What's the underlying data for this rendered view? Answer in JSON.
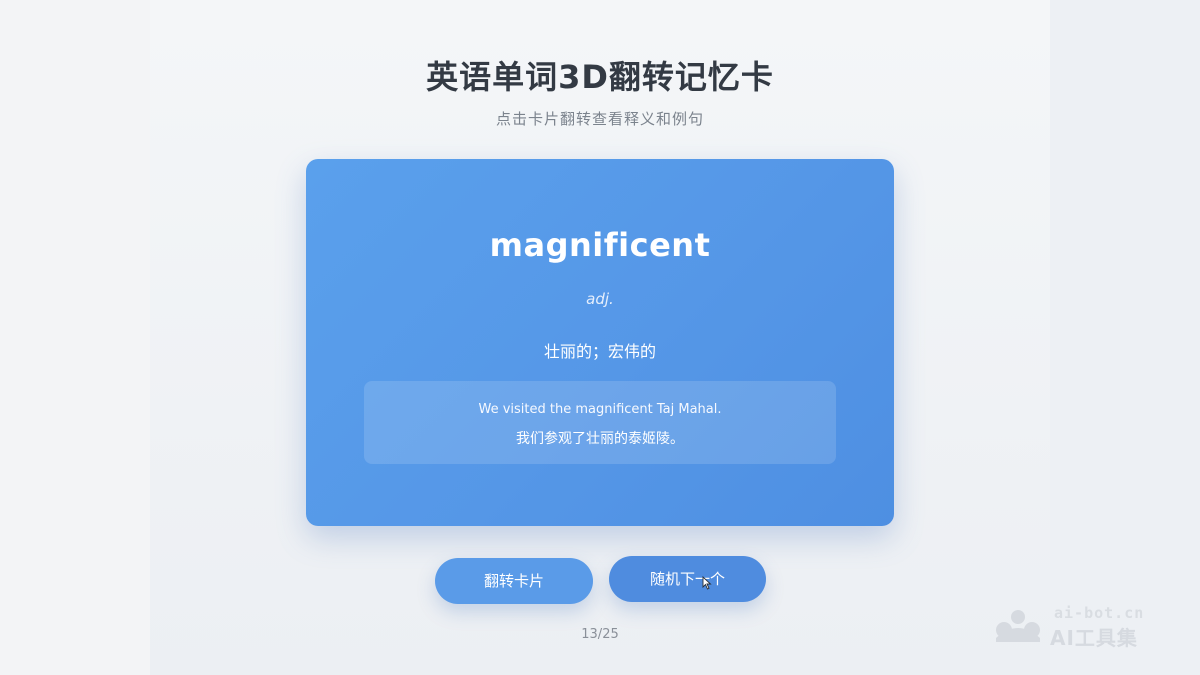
{
  "header": {
    "title": "英语单词3D翻转记忆卡",
    "subtitle": "点击卡片翻转查看释义和例句"
  },
  "card": {
    "word": "magnificent",
    "part_of_speech": "adj.",
    "meaning": "壮丽的；宏伟的",
    "example_en": "We visited the magnificent Taj Mahal.",
    "example_zh": "我们参观了壮丽的泰姬陵。"
  },
  "controls": {
    "flip_label": "翻转卡片",
    "next_label": "随机下一个"
  },
  "progress": {
    "counter": "13/25"
  },
  "watermark": {
    "domain": "ai-bot.cn",
    "name": "AI工具集",
    "icon": "cloud-logo-icon"
  },
  "colors": {
    "card_bg": "#5597e7",
    "button_flip": "#5a9be8",
    "button_next": "#4f8cdf",
    "title_text": "#333a44"
  }
}
